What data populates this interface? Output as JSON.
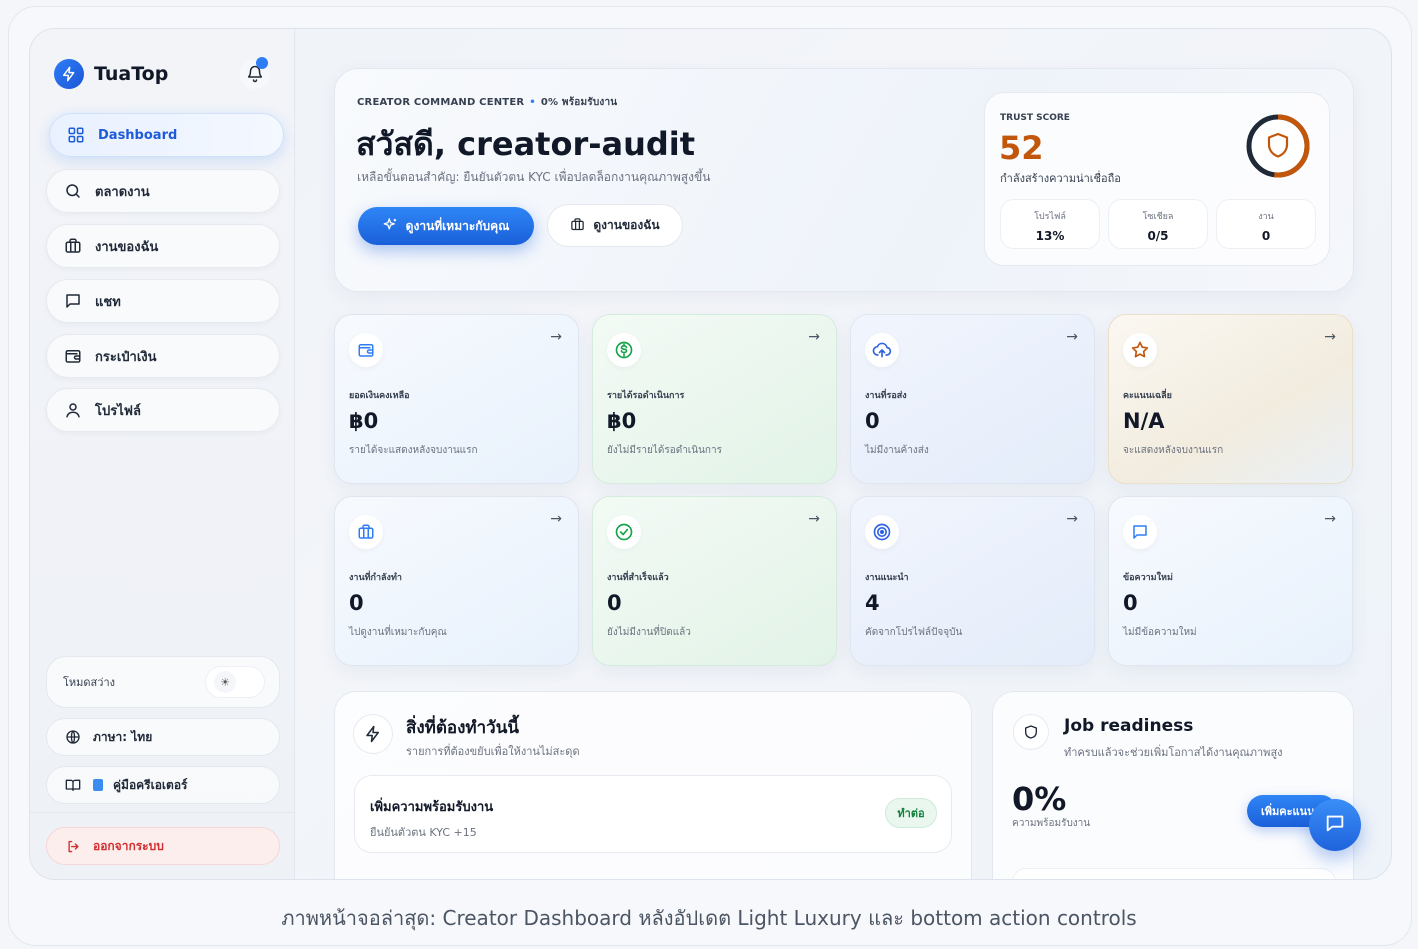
{
  "brand": {
    "name": "TuaTop"
  },
  "sidebar": {
    "items": [
      {
        "label": "Dashboard",
        "icon": "grid-icon",
        "active": true
      },
      {
        "label": "ตลาดงาน",
        "icon": "search-icon"
      },
      {
        "label": "งานของฉัน",
        "icon": "briefcase-icon"
      },
      {
        "label": "แชท",
        "icon": "chat-icon"
      },
      {
        "label": "กระเป๋าเงิน",
        "icon": "wallet-icon"
      },
      {
        "label": "โปรไฟล์",
        "icon": "user-icon"
      }
    ],
    "theme_label": "โหมดสว่าง",
    "language_label": "ภาษา: ไทย",
    "guide_label": "คู่มือครีเอเตอร์",
    "logout_label": "ออกจากระบบ"
  },
  "hero": {
    "eyebrow": "CREATOR COMMAND CENTER",
    "eyebrow_status": "0% พร้อมรับงาน",
    "title": "สวัสดี, creator-audit",
    "subtitle": "เหลือขั้นตอนสำคัญ: ยืนยันตัวตน KYC เพื่อปลดล็อกงานคุณภาพสูงขึ้น",
    "primary_button": "ดูงานที่เหมาะกับคุณ",
    "secondary_button": "ดูงานของฉัน"
  },
  "trust": {
    "label": "TRUST SCORE",
    "score": "52",
    "score_value": 52,
    "subtitle": "กำลังสร้างความน่าเชื่อถือ",
    "stats": [
      {
        "label": "โปรไฟล์",
        "value": "13%"
      },
      {
        "label": "โซเชียล",
        "value": "0/5"
      },
      {
        "label": "งาน",
        "value": "0"
      }
    ]
  },
  "cards": [
    {
      "label": "ยอดเงินคงเหลือ",
      "value": "฿0",
      "sub": "รายได้จะแสดงหลังจบงานแรก",
      "icon": "wallet-icon",
      "tone": "blue"
    },
    {
      "label": "รายได้รอดำเนินการ",
      "value": "฿0",
      "sub": "ยังไม่มีรายได้รอดำเนินการ",
      "icon": "dollar-icon",
      "tone": "green"
    },
    {
      "label": "งานที่รอส่ง",
      "value": "0",
      "sub": "ไม่มีงานค้างส่ง",
      "icon": "upload-cloud-icon",
      "tone": "purple"
    },
    {
      "label": "คะแนนเฉลี่ย",
      "value": "N/A",
      "sub": "จะแสดงหลังจบงานแรก",
      "icon": "star-icon",
      "tone": "gold"
    },
    {
      "label": "งานที่กำลังทำ",
      "value": "0",
      "sub": "ไปดูงานที่เหมาะกับคุณ",
      "icon": "briefcase-icon",
      "tone": "blue"
    },
    {
      "label": "งานที่สำเร็จแล้ว",
      "value": "0",
      "sub": "ยังไม่มีงานที่ปิดแล้ว",
      "icon": "check-circle-icon",
      "tone": "green"
    },
    {
      "label": "งานแนะนำ",
      "value": "4",
      "sub": "คัดจากโปรไฟล์ปัจจุบัน",
      "icon": "target-icon",
      "tone": "purple"
    },
    {
      "label": "ข้อความใหม่",
      "value": "0",
      "sub": "ไม่มีข้อความใหม่",
      "icon": "chat-icon",
      "tone": "blue"
    }
  ],
  "today": {
    "title": "สิ่งที่ต้องทำวันนี้",
    "subtitle": "รายการที่ต้องขยับเพื่อให้งานไม่สะดุด",
    "task_title": "เพิ่มความพร้อมรับงาน",
    "task_sub": "ยืนยันตัวตน KYC +15",
    "task_button": "ทำต่อ"
  },
  "readiness": {
    "title": "Job readiness",
    "subtitle": "ทำครบแล้วจะช่วยเพิ่มโอกาสได้งานคุณภาพสูง",
    "percent": "0%",
    "caption": "ความพร้อมรับงาน",
    "button": "เพิ่มคะแนน"
  },
  "caption": "ภาพหน้าจอล่าสุด: Creator Dashboard หลังอัปเดต Light Luxury และ bottom action controls",
  "colors": {
    "accent": "#1a5fd9",
    "trust": "#c2570c",
    "danger": "#d32f2f",
    "success": "#15803d"
  }
}
